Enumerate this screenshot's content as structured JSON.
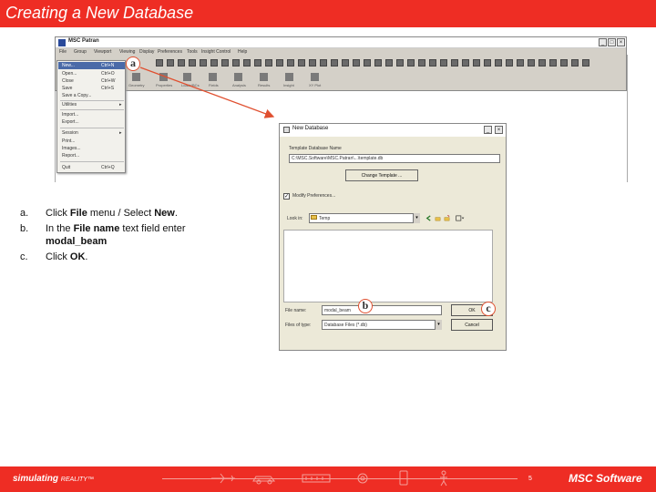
{
  "slide": {
    "title": "Creating a New Database"
  },
  "patran": {
    "title": "MSC Patran",
    "menu": [
      "File",
      "Group",
      "Viewport",
      "Viewing",
      "Display",
      "Preferences",
      "Tools",
      "Insight Control",
      "Help"
    ],
    "toolbar_labels": [
      "Geometry",
      "Properties",
      "Loads/BCs",
      "Fields",
      "Analysis",
      "Results",
      "Insight",
      "XY Plot"
    ]
  },
  "file_menu": {
    "items": [
      {
        "label": "New...",
        "shortcut": "Ctrl+N"
      },
      {
        "label": "Open...",
        "shortcut": "Ctrl+O"
      },
      {
        "label": "Close",
        "shortcut": "Ctrl+W"
      },
      {
        "label": "Save",
        "shortcut": "Ctrl+S"
      },
      {
        "label": "Save a Copy..."
      },
      {
        "label": "Utilities",
        "submenu": true
      },
      {
        "label": "Import..."
      },
      {
        "label": "Export..."
      },
      {
        "label": "Session",
        "submenu": true
      },
      {
        "label": "Print..."
      },
      {
        "label": "Images..."
      },
      {
        "label": "Report..."
      },
      {
        "label": "Quit",
        "shortcut": "Ctrl+Q"
      }
    ]
  },
  "callouts": {
    "a": "a",
    "b": "b",
    "c": "c"
  },
  "steps": [
    {
      "letter": "a.",
      "pre": "Click ",
      "bold1": "File",
      "mid": " menu / Select ",
      "bold2": "New",
      "post": "."
    },
    {
      "letter": "b.",
      "pre": "In the ",
      "bold1": "File name",
      "mid": " text field enter",
      "line2": "modal_beam"
    },
    {
      "letter": "c.",
      "pre": "Click ",
      "bold1": "OK",
      "post": "."
    }
  ],
  "dialog": {
    "title": "New Database",
    "db_name_label": "Template Database Name",
    "db_name_value": "C:\\MSC.Software\\MSC.Patran\\...\\template.db",
    "change_template": "Change Template ...",
    "prefs_label": "Modify Preferences...",
    "lookin_label": "Look in:",
    "lookin_value": "Temp",
    "filename_label": "File name:",
    "filename_value": "modal_beam",
    "filetype_label": "Files of type:",
    "filetype_value": "Database Files (*.db)",
    "ok": "OK",
    "cancel": "Cancel"
  },
  "footer": {
    "left_brand": "simulating ",
    "left_sub": "REALITY™",
    "page_number": "5",
    "right_brand": "MSC Software"
  },
  "colors": {
    "brand_red": "#ee2d24",
    "callout_border": "#e05030",
    "arrow": "#e05030"
  }
}
